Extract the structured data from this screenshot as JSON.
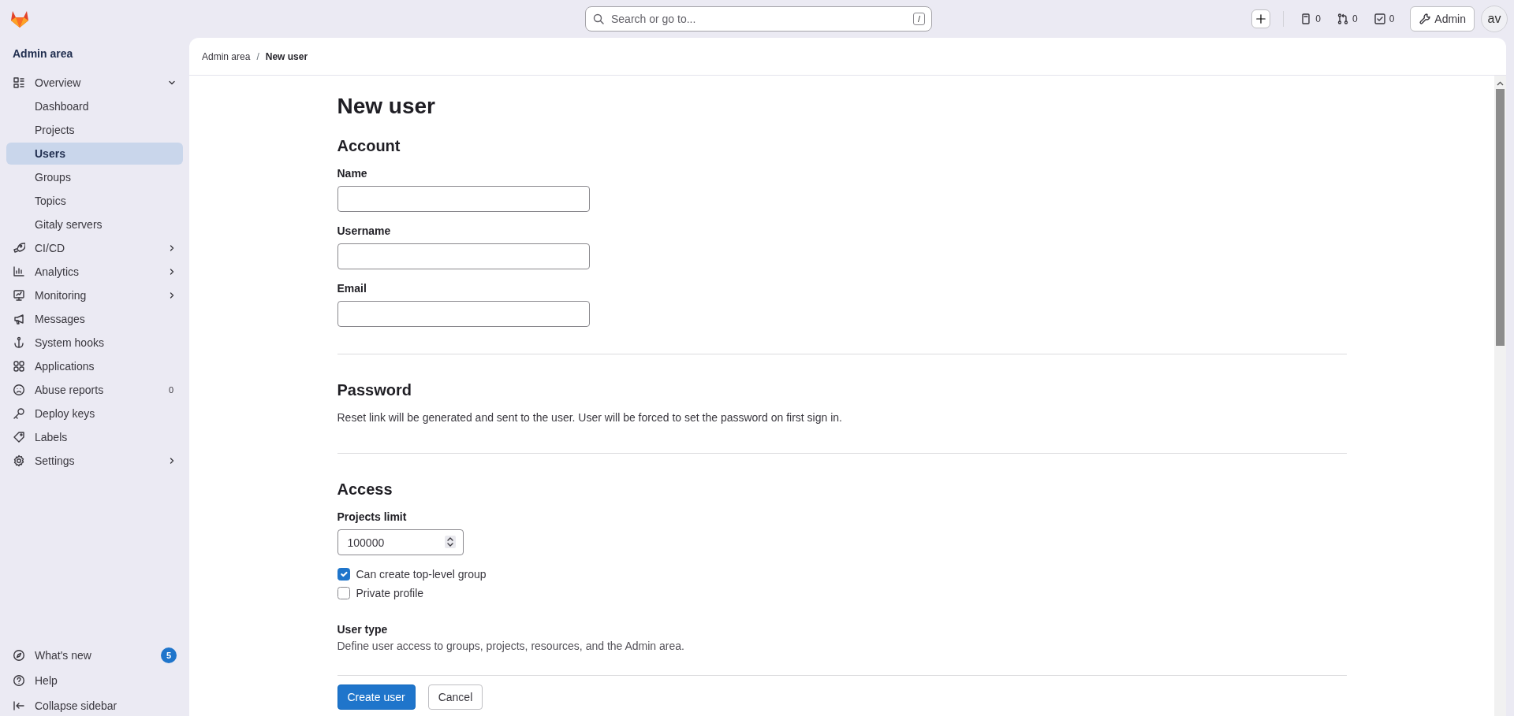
{
  "topbar": {
    "search_placeholder": "Search or go to...",
    "search_shortcut": "/",
    "counters": [
      {
        "kind": "issue",
        "count": "0"
      },
      {
        "kind": "merge",
        "count": "0"
      },
      {
        "kind": "todo",
        "count": "0"
      }
    ],
    "admin_button": "Admin",
    "avatar": "av"
  },
  "sidebar": {
    "title": "Admin area",
    "items": [
      {
        "label": "Overview",
        "kind": "overview",
        "expanded": true,
        "selected": false,
        "children": [
          {
            "label": "Dashboard",
            "selected": false
          },
          {
            "label": "Projects",
            "selected": false
          },
          {
            "label": "Users",
            "selected": true
          },
          {
            "label": "Groups",
            "selected": false
          },
          {
            "label": "Topics",
            "selected": false
          },
          {
            "label": "Gitaly servers",
            "selected": false
          }
        ]
      },
      {
        "label": "CI/CD",
        "kind": "rocket",
        "expanded": false,
        "selected": false
      },
      {
        "label": "Analytics",
        "kind": "chart",
        "expanded": false,
        "selected": false
      },
      {
        "label": "Monitoring",
        "kind": "monitor",
        "expanded": false,
        "selected": false
      },
      {
        "label": "Messages",
        "kind": "megaphone",
        "selected": false
      },
      {
        "label": "System hooks",
        "kind": "anchor",
        "selected": false
      },
      {
        "label": "Applications",
        "kind": "apps",
        "selected": false
      },
      {
        "label": "Abuse reports",
        "kind": "sad",
        "badge": "0",
        "selected": false
      },
      {
        "label": "Deploy keys",
        "kind": "key",
        "selected": false
      },
      {
        "label": "Labels",
        "kind": "tag",
        "selected": false
      },
      {
        "label": "Settings",
        "kind": "gear",
        "expanded": false,
        "selected": false
      }
    ],
    "footer_items": [
      {
        "label": "What's new",
        "kind": "compass",
        "badge": "5"
      },
      {
        "label": "Help",
        "kind": "question"
      },
      {
        "label": "Collapse sidebar",
        "kind": "collapse"
      }
    ]
  },
  "breadcrumb": {
    "separator": "/",
    "items": [
      {
        "label": "Admin area",
        "current": false
      },
      {
        "label": "New user",
        "current": true
      }
    ]
  },
  "page_title": "New user",
  "sections": [
    {
      "title": "Account",
      "fields": [
        {
          "label": "Name",
          "kind": "text"
        },
        {
          "label": "Username",
          "kind": "text"
        },
        {
          "label": "Email",
          "kind": "text"
        }
      ]
    },
    {
      "title": "Password",
      "description": "Reset link will be generated and sent to the user. User will be forced to set the password on first sign in."
    },
    {
      "title": "Access",
      "fields": [
        {
          "label": "Projects limit",
          "kind": "number",
          "value": "100000"
        }
      ],
      "checkboxes": [
        {
          "label": "Can create top-level group",
          "checked": true
        },
        {
          "label": "Private profile",
          "checked": false
        }
      ],
      "subsections": [
        {
          "title": "User type",
          "description": "Define user access to groups, projects, resources, and the Admin area."
        }
      ]
    }
  ],
  "actions": [
    {
      "label": "Create user",
      "kind": "primary"
    },
    {
      "label": "Cancel",
      "kind": "secondary"
    }
  ]
}
